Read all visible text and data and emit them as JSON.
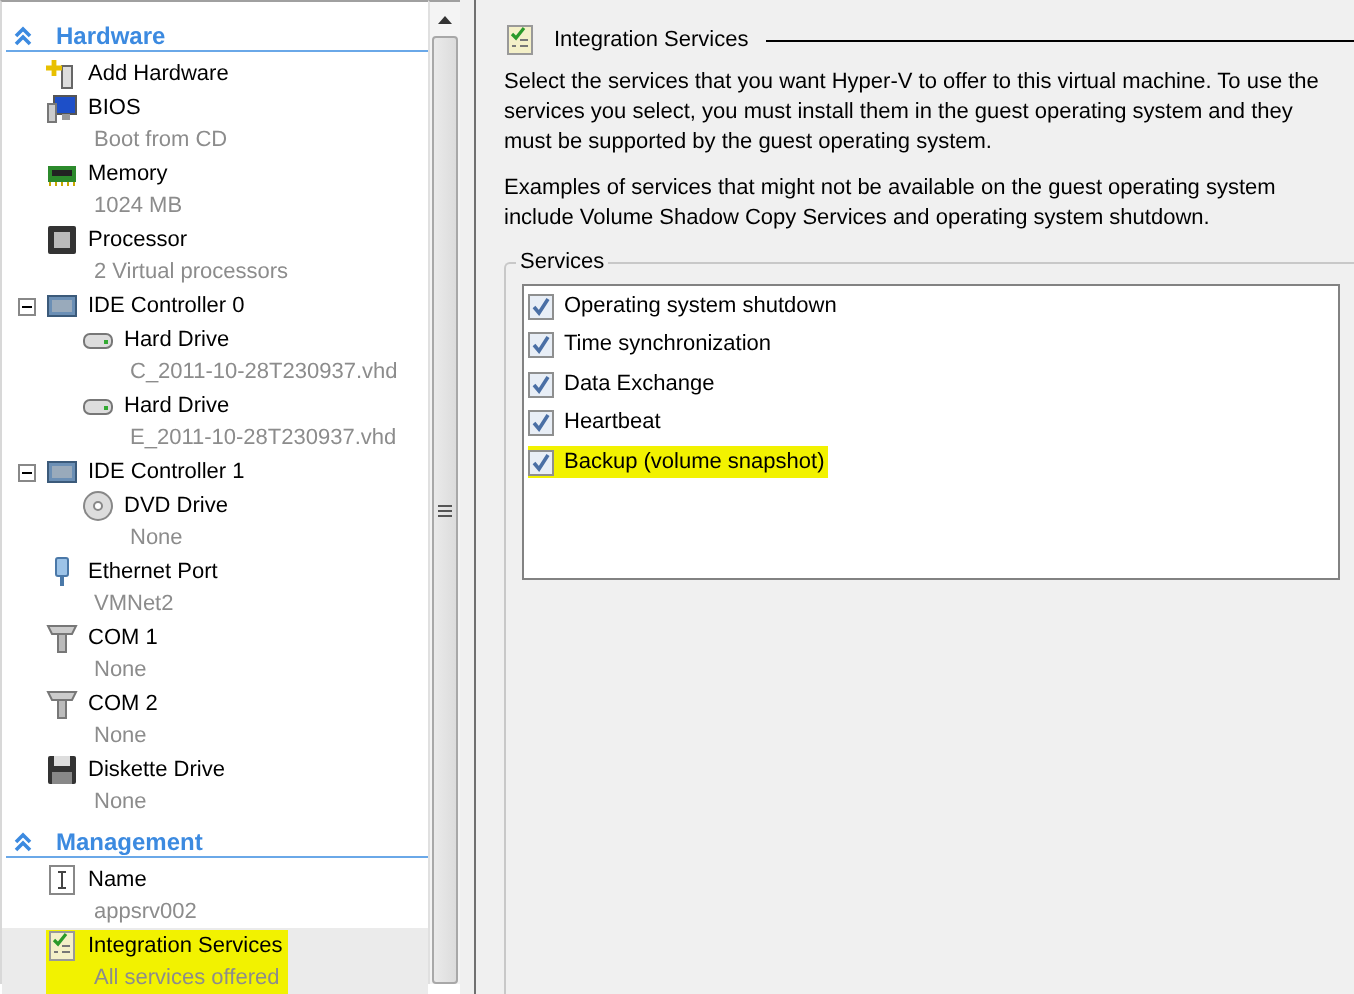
{
  "sidebar": {
    "sections": [
      {
        "title": "Hardware",
        "expanded": true,
        "items": [
          {
            "kind": "add-hardware",
            "label": "Add Hardware",
            "selected": false,
            "highlighted": false
          },
          {
            "kind": "bios",
            "label": "BIOS",
            "detail": "Boot from CD",
            "selected": false,
            "highlighted": false
          },
          {
            "kind": "memory",
            "label": "Memory",
            "detail": "1024 MB",
            "selected": false,
            "highlighted": false
          },
          {
            "kind": "processor",
            "label": "Processor",
            "detail": "2 Virtual processors",
            "selected": false,
            "highlighted": false
          },
          {
            "kind": "ide",
            "label": "IDE Controller 0",
            "selected": false,
            "highlighted": false,
            "expanded": true,
            "children": [
              {
                "kind": "hard-drive",
                "label": "Hard Drive",
                "detail": "C_2011-10-28T230937.vhd",
                "selected": false,
                "highlighted": false
              },
              {
                "kind": "hard-drive",
                "label": "Hard Drive",
                "detail": "E_2011-10-28T230937.vhd",
                "selected": false,
                "highlighted": false
              }
            ]
          },
          {
            "kind": "ide",
            "label": "IDE Controller 1",
            "selected": false,
            "highlighted": false,
            "expanded": true,
            "children": [
              {
                "kind": "dvd",
                "label": "DVD Drive",
                "detail": "None",
                "selected": false,
                "highlighted": false
              }
            ]
          },
          {
            "kind": "ethernet",
            "label": "Ethernet Port",
            "detail": "VMNet2",
            "selected": false,
            "highlighted": false
          },
          {
            "kind": "com",
            "label": "COM 1",
            "detail": "None",
            "selected": false,
            "highlighted": false
          },
          {
            "kind": "com",
            "label": "COM 2",
            "detail": "None",
            "selected": false,
            "highlighted": false
          },
          {
            "kind": "diskette",
            "label": "Diskette Drive",
            "detail": "None",
            "selected": false,
            "highlighted": false
          }
        ]
      },
      {
        "title": "Management",
        "expanded": true,
        "items": [
          {
            "kind": "name",
            "label": "Name",
            "detail": "appsrv002",
            "selected": false,
            "highlighted": false
          },
          {
            "kind": "integration",
            "label": "Integration Services",
            "detail": "All services offered",
            "selected": true,
            "highlighted": true
          }
        ]
      }
    ]
  },
  "pane": {
    "title": "Integration Services",
    "paragraphs": [
      "Select the services that you want Hyper-V to offer to this virtual machine. To use the services you select, you must install them in the guest operating system and they must be supported by the guest operating system.",
      "Examples of services that might not be available on the guest operating system include Volume Shadow Copy Services and operating system shutdown."
    ],
    "group_title": "Services",
    "services": [
      {
        "label": "Operating system shutdown",
        "checked": true,
        "highlighted": false
      },
      {
        "label": "Time synchronization",
        "checked": true,
        "highlighted": false
      },
      {
        "label": "Data Exchange",
        "checked": true,
        "highlighted": false
      },
      {
        "label": "Heartbeat",
        "checked": true,
        "highlighted": false
      },
      {
        "label": "Backup (volume snapshot)",
        "checked": true,
        "highlighted": true
      }
    ]
  }
}
